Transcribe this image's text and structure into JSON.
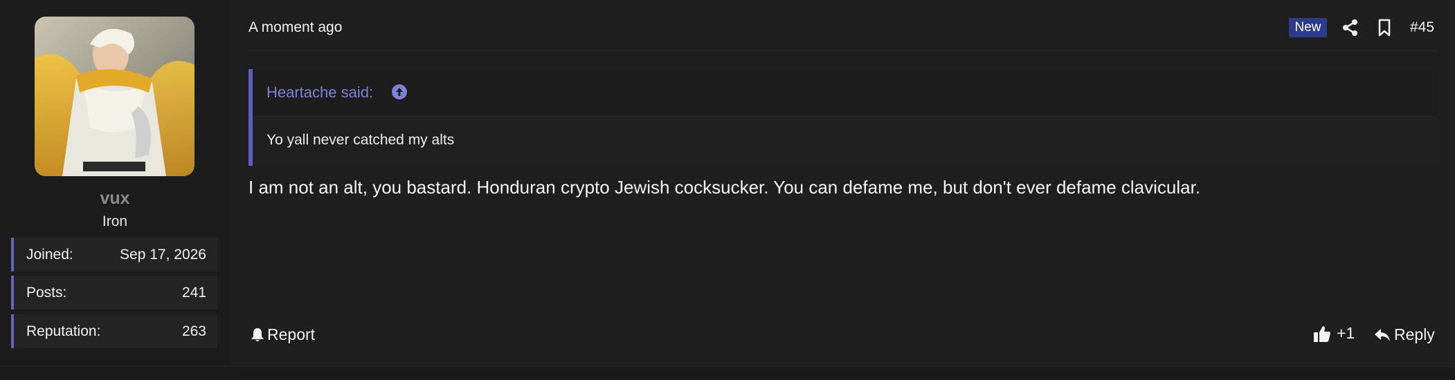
{
  "user": {
    "name": "vux",
    "rank": "Iron",
    "stats": [
      {
        "label": "Joined:",
        "value": "Sep 17, 2026"
      },
      {
        "label": "Posts:",
        "value": "241"
      },
      {
        "label": "Reputation:",
        "value": "263"
      }
    ]
  },
  "post": {
    "time": "A moment ago",
    "badge": "New",
    "number": "#45",
    "quote": {
      "author": "Heartache said:",
      "body": "Yo yall never catched my alts"
    },
    "message": "I am not an alt, you bastard. Honduran crypto Jewish cocksucker. You can defame me, but don't ever defame clavicular.",
    "actions": {
      "report": "Report",
      "like_count": "+1",
      "reply": "Reply"
    }
  },
  "colors": {
    "accent": "#6467b9",
    "quote_author": "#7d82d8",
    "badge_bg": "#2e3a8a"
  }
}
